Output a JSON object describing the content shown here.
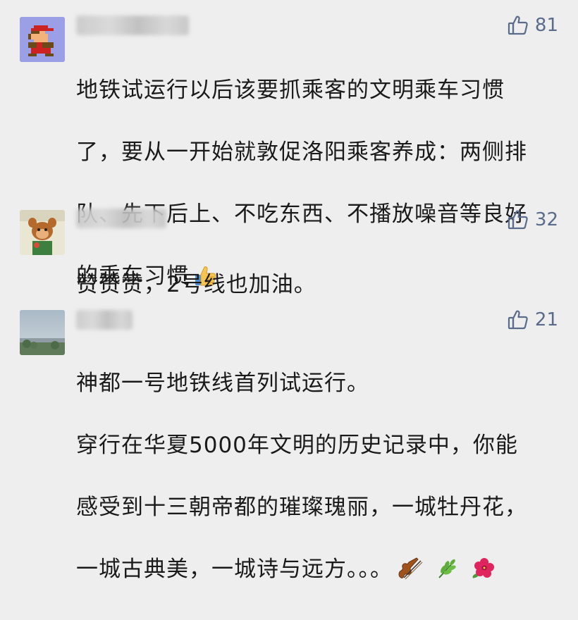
{
  "comments": [
    {
      "likes": "81",
      "text_lines": [
        "地铁试运行以后该要抓乘客的文明乘车习惯",
        "了，要从一开始就敦促洛阳乘客养成：两侧排",
        "队、先下后上、不吃东西、不播放噪音等良好",
        "的乘车习惯"
      ],
      "trailing_emoji": [
        "thumbs-up-emoji"
      ]
    },
    {
      "likes": "32",
      "text_lines": [
        "赞赞赞，2号线也加油。"
      ],
      "trailing_emoji": []
    },
    {
      "likes": "21",
      "text_lines": [
        "神都一号地铁线首列试运行。",
        "穿行在华夏5000年文明的历史记录中，你能",
        "感受到十三朝帝都的璀璨瑰丽，一城牡丹花，",
        "一城古典美，一城诗与远方。。。"
      ],
      "trailing_emoji": [
        "violin-emoji",
        "herb-emoji",
        "hibiscus-emoji"
      ]
    }
  ],
  "colors": {
    "background": "#eeeeee",
    "text": "#1a1a1a",
    "like_color": "#5a6b8c"
  }
}
